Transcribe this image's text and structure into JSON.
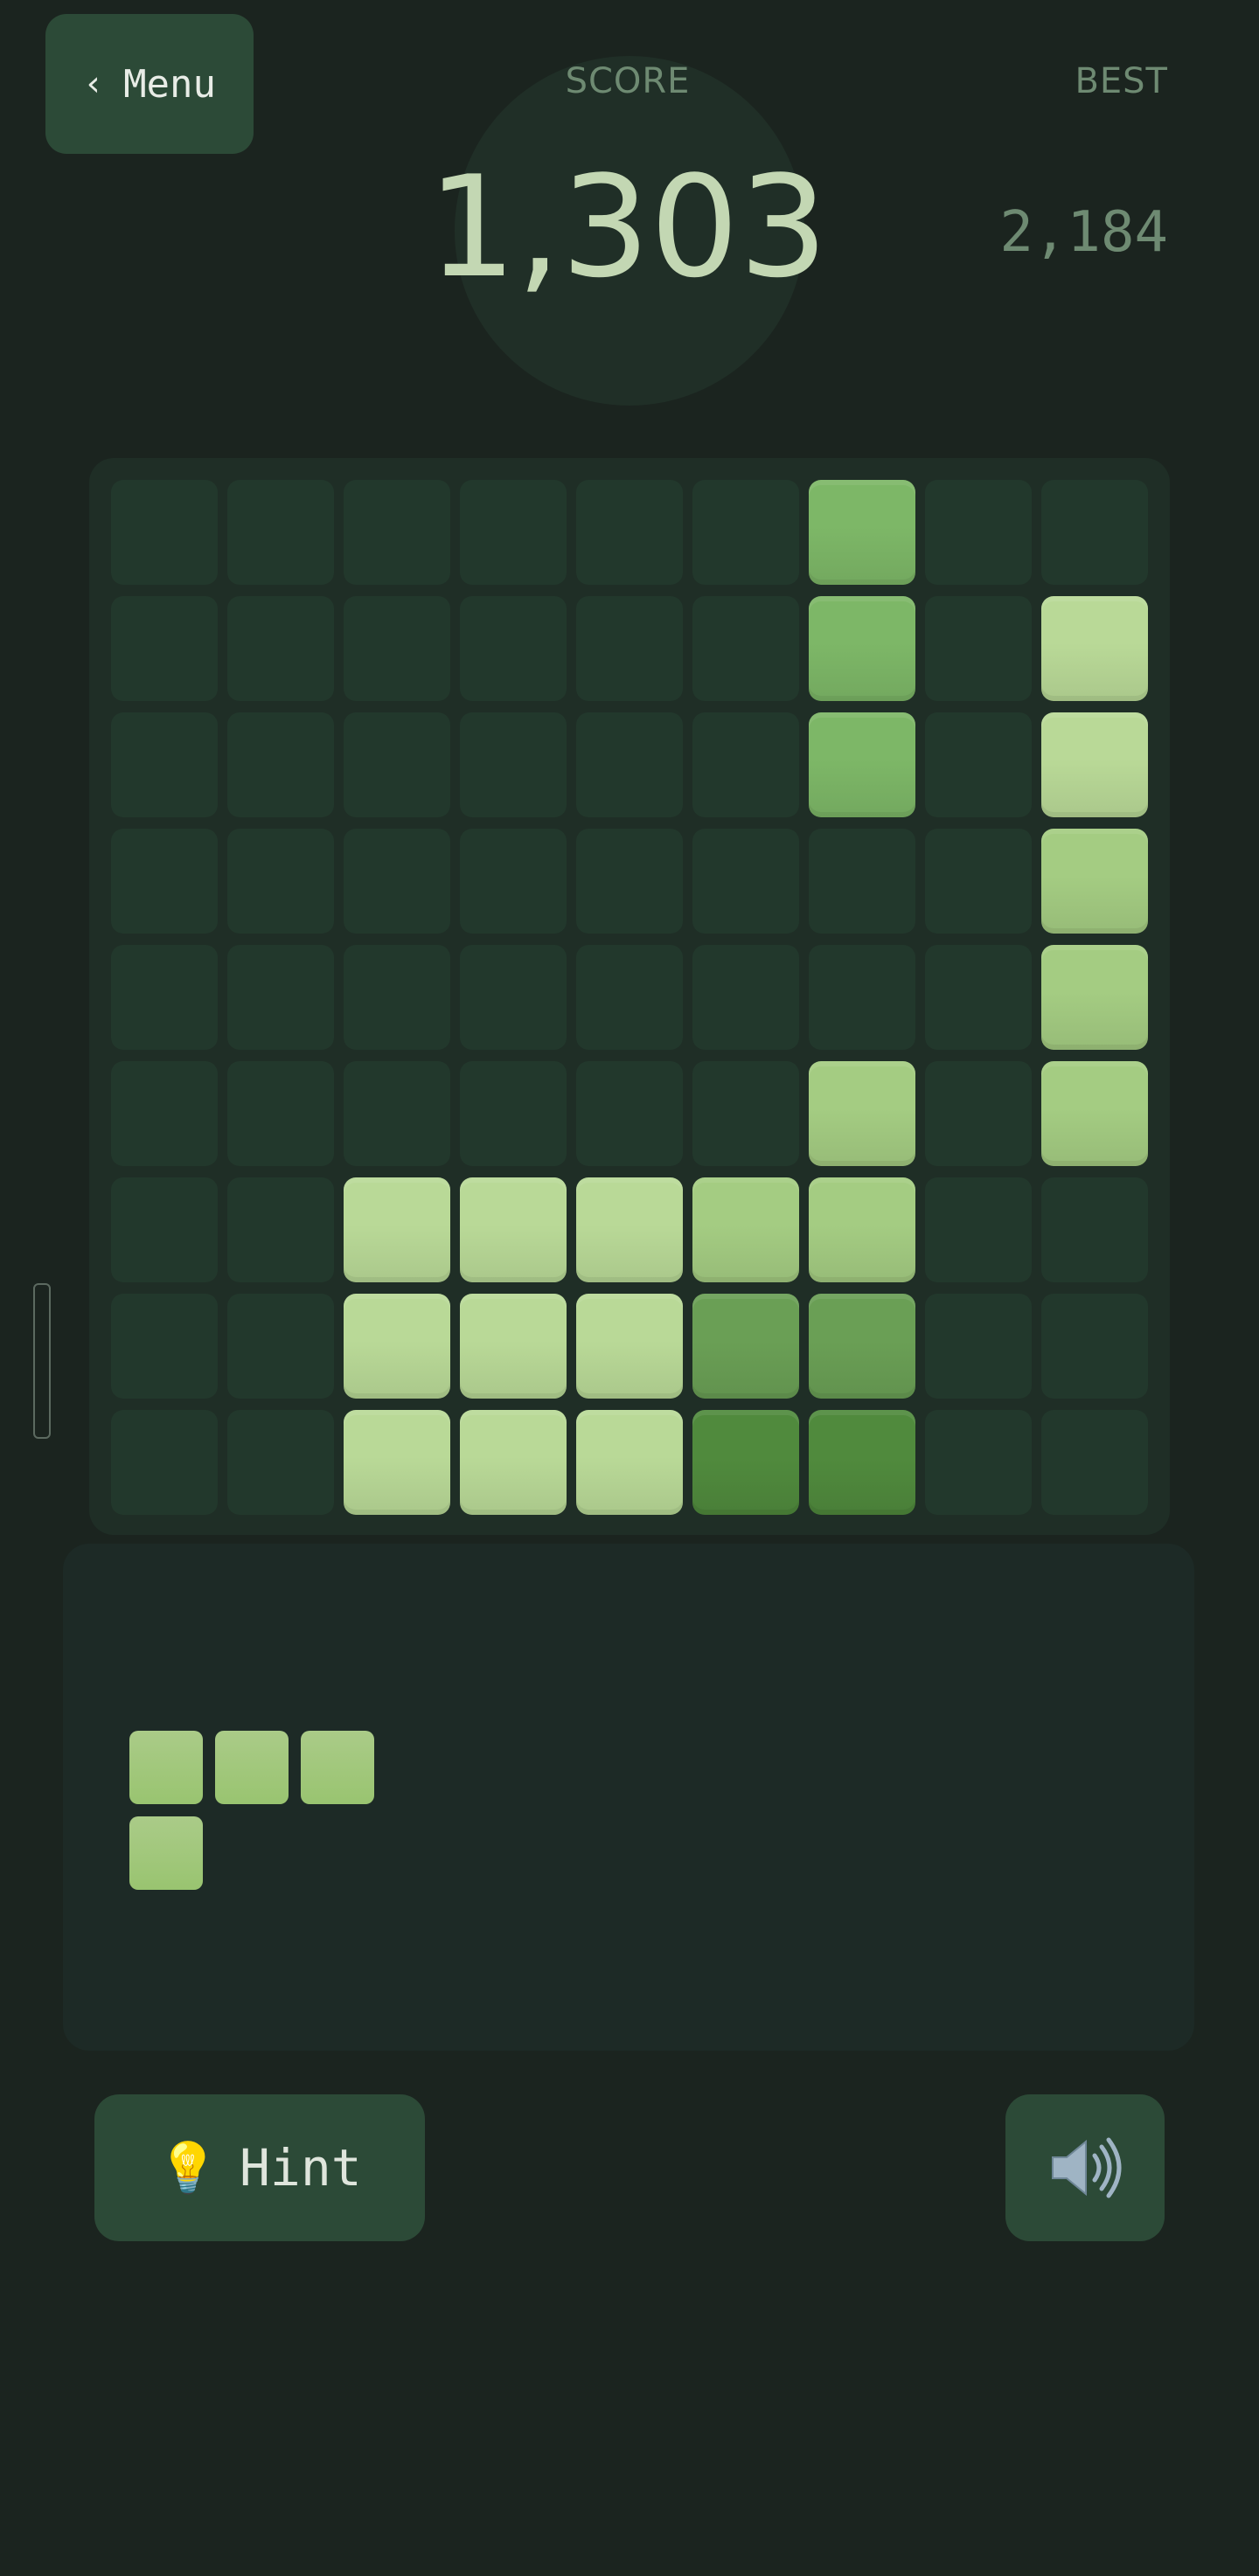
{
  "menu": {
    "chevron": "‹",
    "label": "Menu"
  },
  "score": {
    "label": "SCORE",
    "value": "1,303"
  },
  "best": {
    "label": "BEST",
    "value": "2,184"
  },
  "board": {
    "rows": 9,
    "cols": 9,
    "palette": {
      "0": "#22382c",
      "1": "#b9d997",
      "2": "#a4cc82",
      "3": "#7db767",
      "4": "#6a9f55",
      "5": "#508a3d"
    },
    "grid": [
      [
        0,
        0,
        0,
        0,
        0,
        0,
        3,
        0,
        0
      ],
      [
        0,
        0,
        0,
        0,
        0,
        0,
        3,
        0,
        1
      ],
      [
        0,
        0,
        0,
        0,
        0,
        0,
        3,
        0,
        1
      ],
      [
        0,
        0,
        0,
        0,
        0,
        0,
        0,
        0,
        2
      ],
      [
        0,
        0,
        0,
        0,
        0,
        0,
        0,
        0,
        2
      ],
      [
        0,
        0,
        0,
        0,
        0,
        0,
        2,
        0,
        2
      ],
      [
        0,
        0,
        1,
        1,
        1,
        2,
        2,
        0,
        0
      ],
      [
        0,
        0,
        1,
        1,
        1,
        4,
        4,
        0,
        0
      ],
      [
        0,
        0,
        1,
        1,
        1,
        5,
        5,
        0,
        0
      ]
    ]
  },
  "tray": {
    "piece_shape": [
      [
        1,
        1,
        1
      ],
      [
        1,
        0,
        0
      ]
    ]
  },
  "hint": {
    "icon": "lightbulb-icon",
    "glyph": "💡",
    "label": "Hint"
  },
  "sound": {
    "icon": "speaker-icon"
  }
}
